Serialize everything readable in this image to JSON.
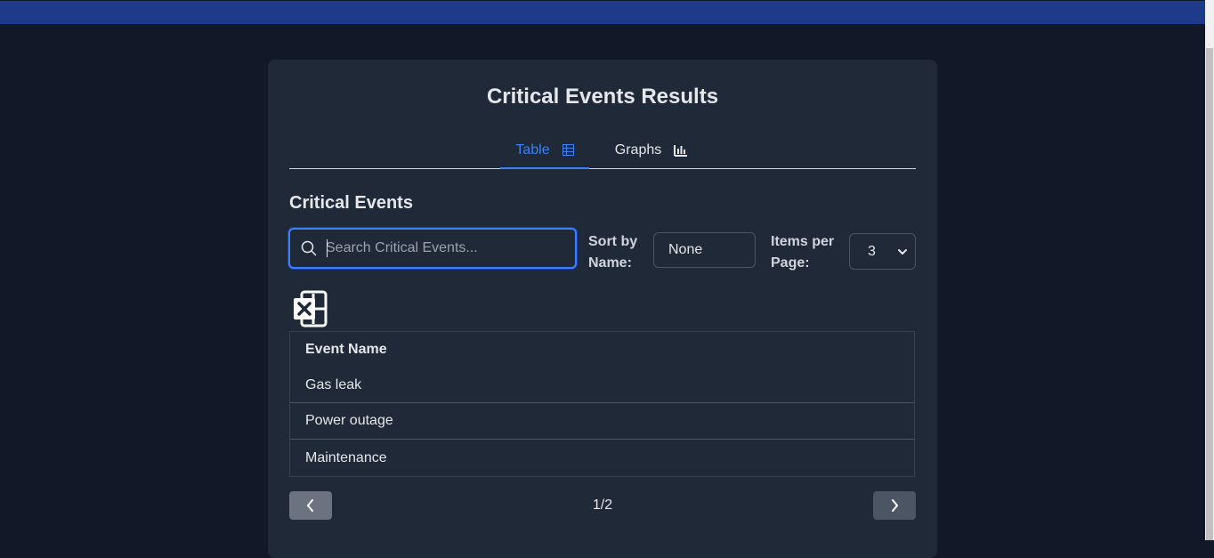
{
  "page": {
    "title": "Critical Events Results"
  },
  "tabs": [
    {
      "label": "Table",
      "icon": "table-icon",
      "active": true
    },
    {
      "label": "Graphs",
      "icon": "bar-chart-icon",
      "active": false
    }
  ],
  "section": {
    "title": "Critical Events"
  },
  "search": {
    "placeholder": "Search Critical Events...",
    "value": ""
  },
  "sort": {
    "label": "Sort by Name:",
    "value": "None"
  },
  "items_per_page": {
    "label": "Items per Page:",
    "value": "3"
  },
  "export": {
    "icon": "excel-icon"
  },
  "table": {
    "header": "Event Name",
    "rows": [
      "Gas leak",
      "Power outage",
      "Maintenance"
    ]
  },
  "pagination": {
    "indicator": "1/2",
    "current": 1,
    "total": 2
  },
  "colors": {
    "accent": "#3b82f6",
    "topbar": "#1e3a8a",
    "background": "#111827",
    "card": "#1f2937"
  }
}
